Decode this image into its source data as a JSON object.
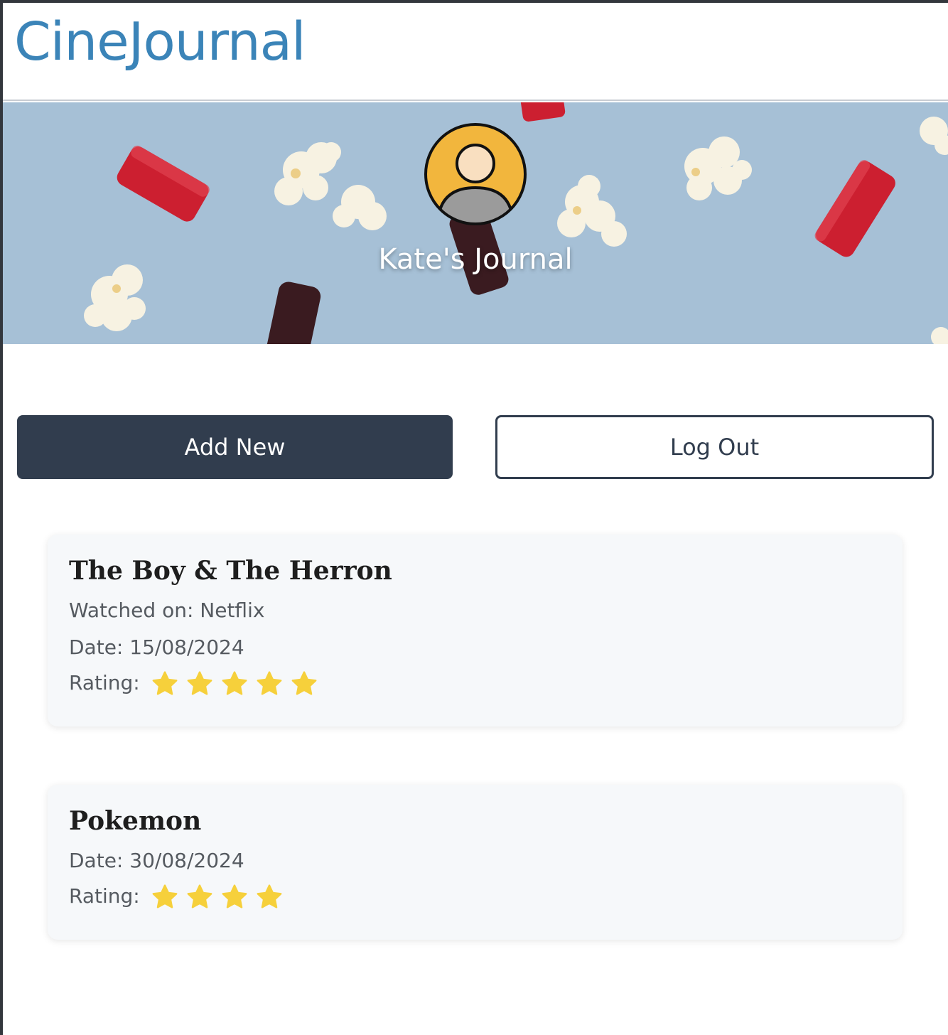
{
  "app": {
    "brand": "CineJournal"
  },
  "profile": {
    "journal_title": "Kate's Journal"
  },
  "actions": {
    "add_new_label": "Add New",
    "logout_label": "Log Out"
  },
  "entries": [
    {
      "title": "The Boy & The Herron",
      "watched_on_text": "Watched on: Netflix",
      "date_text": "Date: 15/08/2024",
      "rating_label": "Rating:",
      "rating": 5
    },
    {
      "title": "Pokemon",
      "date_text": "Date: 30/08/2024",
      "rating_label": "Rating:",
      "rating": 4
    }
  ],
  "colors": {
    "brand": "#3b84b8",
    "primary_button": "#313d4e",
    "star": "#f6d03b",
    "avatar_bg": "#f2b63d"
  },
  "icons": {
    "avatar": "user-avatar-icon",
    "rating": "star-icon"
  }
}
